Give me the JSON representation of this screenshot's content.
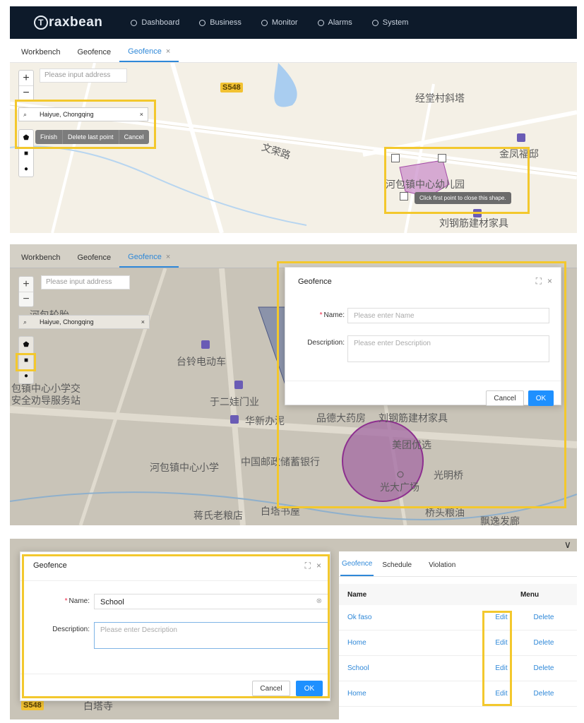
{
  "brand": {
    "logo_text": "raxbean",
    "logo_letter": "T"
  },
  "nav": [
    "Dashboard",
    "Business",
    "Monitor",
    "Alarms",
    "System"
  ],
  "tabs": {
    "workbench": "Workbench",
    "geofence": "Geofence",
    "geofence_active": "Geofence",
    "close": "×"
  },
  "map": {
    "address_placeholder": "Please input address",
    "search_value": "Haiyue, Chongqing",
    "clear": "×",
    "zoom_in": "+",
    "zoom_out": "−",
    "draw_actions": [
      "Finish",
      "Delete last point",
      "Cancel"
    ],
    "tooltip": "Click first point to close this shape.",
    "labels1": [
      "S548",
      "经堂村斜塔",
      "文荣路",
      "金凤福邸",
      "河包镇中心幼儿园",
      "刘钢筋建材家具"
    ],
    "labels2": [
      "河包轮胎",
      "台铃电动车",
      "包镇中心小学交",
      "安全劝导服务站",
      "于二娃门业",
      "华新办泥",
      "品德大药房",
      "刘钢筋建材家具",
      "美团优选",
      "河包镇中心小学",
      "中国邮政储蓄银行",
      "光大广场",
      "光明桥",
      "蒋氏老粮店",
      "白塔书屋",
      "桥头粮油",
      "飘逸发廊"
    ],
    "labels3": [
      "S548",
      "白塔寺"
    ]
  },
  "dialog": {
    "title": "Geofence",
    "name_label": "Name:",
    "required": "*",
    "name_placeholder": "Please enter Name",
    "name_value": "School",
    "desc_label": "Description:",
    "desc_placeholder": "Please enter Description",
    "cancel": "Cancel",
    "ok": "OK",
    "expand_icon": "⛶",
    "close_icon": "×"
  },
  "list": {
    "tabs": [
      "Geofence",
      "Schedule",
      "Violation"
    ],
    "headers": {
      "name": "Name",
      "menu": "Menu"
    },
    "rows": [
      {
        "name": "Ok faso",
        "edit": "Edit",
        "delete": "Delete"
      },
      {
        "name": "Home",
        "edit": "Edit",
        "delete": "Delete"
      },
      {
        "name": "School",
        "edit": "Edit",
        "delete": "Delete"
      },
      {
        "name": "Home",
        "edit": "Edit",
        "delete": "Delete"
      }
    ],
    "collapse_icon": "∨"
  },
  "colors": {
    "highlight": "#f3c82d",
    "accent": "#2f88d8",
    "ok": "#1e90ff",
    "fence": "#b45bb5"
  }
}
